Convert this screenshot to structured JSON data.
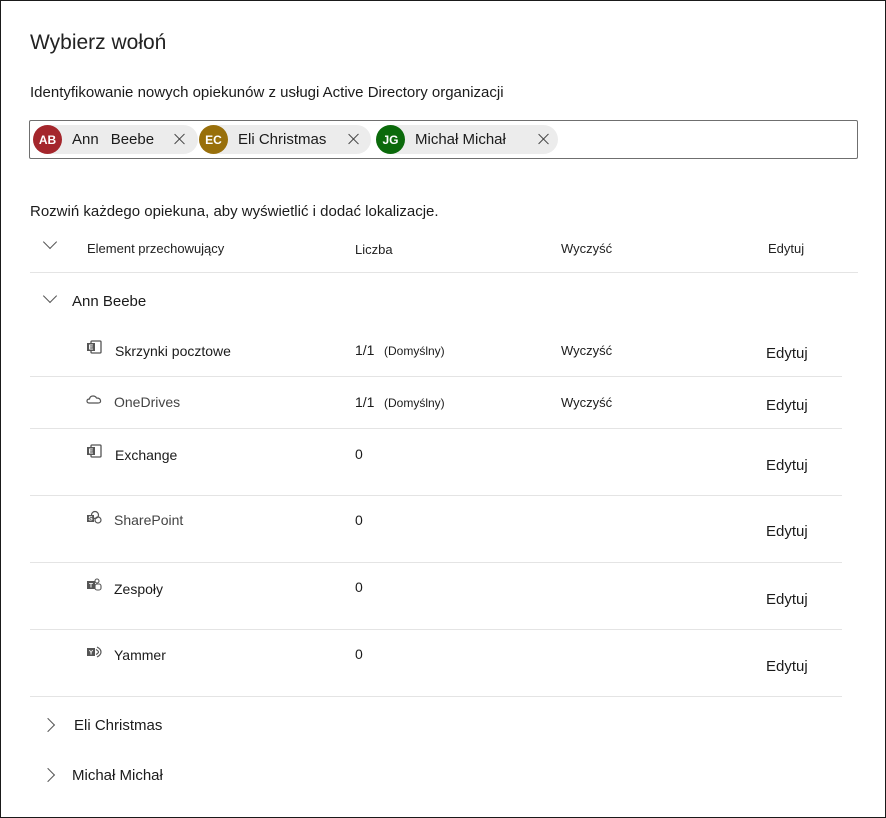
{
  "dialog": {
    "title": "Wybierz wołoń",
    "subtitle": "Identyfikowanie nowych opiekunów z usługi Active Directory organizacji",
    "instruction": "Rozwiń każdego opiekuna, aby wyświetlić i dodać lokalizacje."
  },
  "picker": {
    "chips": [
      {
        "initials": "AB",
        "first": "Ann",
        "last": "Beebe",
        "color": "#a4262c"
      },
      {
        "initials": "EC",
        "name": "Eli Christmas",
        "color": "#986f0b"
      },
      {
        "initials": "JG",
        "name": "Michał Michał",
        "color": "#0b6a0b"
      }
    ]
  },
  "table": {
    "headers": {
      "element": "Element przechowujący",
      "count": "Liczba",
      "clear": "Wyczyść",
      "edit": "Edytuj"
    }
  },
  "custodians": [
    {
      "name": "Ann Beebe",
      "locations": [
        {
          "icon": "exchange-icon",
          "name": "Skrzynki pocztowe",
          "count": "1/1",
          "default": "(Domyślny)",
          "clear": "Wyczyść",
          "edit": "Edytuj"
        },
        {
          "icon": "onedrive-icon",
          "name": "OneDrives",
          "count": "1/1",
          "default": "(Domyślny)",
          "clear": "Wyczyść",
          "edit": "Edytuj"
        },
        {
          "icon": "exchange-icon",
          "name": "Exchange",
          "count": "0",
          "default": "",
          "clear": "",
          "edit": "Edytuj"
        },
        {
          "icon": "sharepoint-icon",
          "name": "SharePoint",
          "count": "0",
          "default": "",
          "clear": "",
          "edit": "Edytuj"
        },
        {
          "icon": "teams-icon",
          "name": "Zespoły",
          "count": "0",
          "default": "",
          "clear": "",
          "edit": "Edytuj"
        },
        {
          "icon": "yammer-icon",
          "name": "Yammer",
          "count": "0",
          "default": "",
          "clear": "",
          "edit": "Edytuj"
        }
      ]
    },
    {
      "name": "Eli Christmas"
    },
    {
      "name": "Michał Michał"
    }
  ]
}
